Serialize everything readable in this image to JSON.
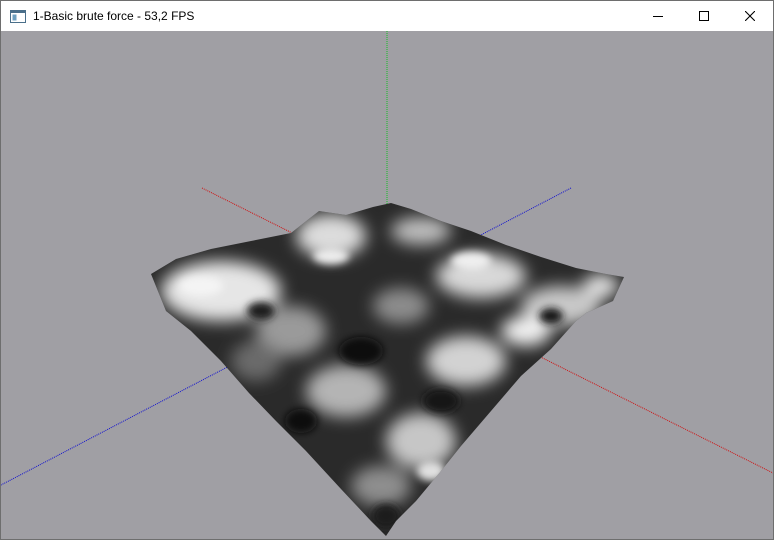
{
  "window": {
    "title": "1-Basic brute force - 53,2 FPS",
    "icon": "app-window-icon"
  },
  "controls": {
    "minimize": "minimize-icon",
    "maximize": "maximize-icon",
    "close": "close-icon"
  },
  "scene": {
    "background": "#a09fa4",
    "axis_colors": {
      "x": "#d01010",
      "y": "#10c020",
      "z": "#1010d0"
    },
    "terrain": "grayscale-heightmap"
  }
}
